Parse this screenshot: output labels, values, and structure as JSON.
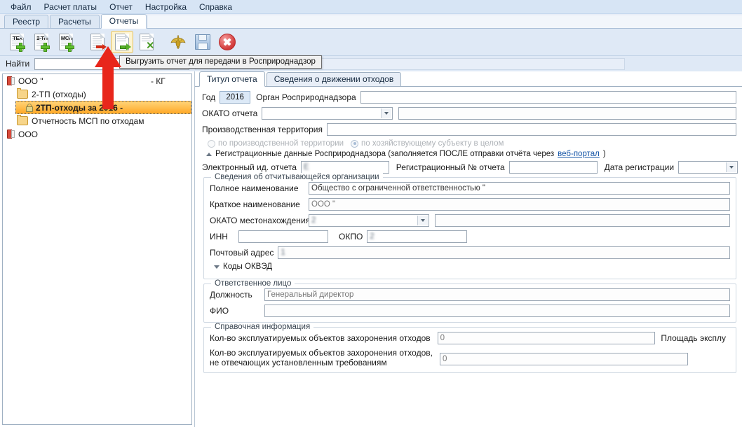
{
  "window": {
    "menu": [
      "Файл",
      "Расчет платы",
      "Отчет",
      "Настройка",
      "Справка"
    ],
    "main_tabs": [
      {
        "label": "Реестр",
        "active": false
      },
      {
        "label": "Расчеты",
        "active": false
      },
      {
        "label": "Отчеты",
        "active": true
      }
    ]
  },
  "toolbar": {
    "buttons": [
      {
        "name": "new-teh-report",
        "label": "ТЕХ",
        "icon": "document-plus-icon"
      },
      {
        "name": "new-2tp-report",
        "label": "2-ТП",
        "icon": "document-plus-icon"
      },
      {
        "name": "new-msp-report",
        "label": "МСП",
        "icon": "document-plus-icon"
      },
      {
        "name": "print-report",
        "label": "",
        "icon": "document-red-arrow-icon"
      },
      {
        "name": "export-report",
        "label": "",
        "icon": "document-green-arrow-icon"
      },
      {
        "name": "import-report",
        "label": "",
        "icon": "document-green-x-icon"
      },
      {
        "name": "rosprirodnadzor-portal",
        "label": "",
        "icon": "eagle-emblem-icon"
      },
      {
        "name": "save-report",
        "label": "",
        "icon": "floppy-save-icon"
      },
      {
        "name": "close-report",
        "label": "",
        "icon": "red-close-circle-icon"
      }
    ],
    "tooltip": "Выгрузить отчет для передачи в Росприроднадзор"
  },
  "find": {
    "label": "Найти",
    "value": "",
    "placeholder": ""
  },
  "tree": {
    "nodes": [
      {
        "level": 1,
        "icon": "book-icon",
        "text": "ООО \"",
        "blurred": "                                        ",
        "suffix": "- КГ",
        "selected": false
      },
      {
        "level": 2,
        "icon": "folder-icon",
        "text": "2-ТП (отходы)",
        "blurred": "",
        "suffix": "",
        "selected": false
      },
      {
        "level": 3,
        "icon": "lock-icon",
        "text": "2ТП-отходы за 2016 -",
        "blurred": "                   ",
        "suffix": "",
        "selected": true
      },
      {
        "level": 2,
        "icon": "folder-icon",
        "text": "Отчетность МСП по отходам",
        "blurred": "",
        "suffix": "",
        "selected": false
      },
      {
        "level": 1,
        "icon": "book-icon",
        "text": "ООО",
        "blurred": "                                            ",
        "suffix": "",
        "selected": false
      }
    ]
  },
  "form": {
    "tabs": [
      {
        "label": "Титул отчета",
        "active": true
      },
      {
        "label": "Сведения о движении отходов",
        "active": false
      }
    ],
    "year_label": "Год",
    "year_value": "2016",
    "organ_label": "Орган Росприроднадзора",
    "organ_value": "",
    "okato_report_label": "ОКАТО отчета",
    "okato_report_value": "",
    "okato_report_name": "",
    "territory_label": "Производственная территория",
    "territory_value": "",
    "radio_by_territory": "по производственной территории",
    "radio_by_entity": "по хозяйствующему субъекту в целом",
    "reg_section": "Регистрационные данные Росприроднадзора (заполняется ПОСЛЕ отправки отчёта через",
    "reg_link": "веб-портал",
    "reg_section_end": ")",
    "eid_label": "Электронный ид. отчета",
    "eid_value": "",
    "regnum_label": "Регистрационный № отчета",
    "regnum_value": "",
    "regdate_label": "Дата регистрации",
    "regdate_value": "",
    "org_group_title": "Сведения об отчитывающейся организации",
    "fullname_label": "Полное наименование",
    "fullname_value": "Общество с ограниченной ответственностью \"",
    "shortname_label": "Краткое наименование",
    "shortname_value": "ООО \"",
    "okato_loc_label": "ОКАТО местонахождения",
    "okato_loc_value": "",
    "okato_loc_name": "",
    "inn_label": "ИНН",
    "inn_value": "",
    "okpo_label": "ОКПО",
    "okpo_value": "",
    "postal_label": "Почтовый адрес",
    "postal_value": "",
    "okved_label": "Коды ОКВЭД",
    "resp_group_title": "Ответственное лицо",
    "position_label": "Должность",
    "position_value": "Генеральный директор",
    "fio_label": "ФИО",
    "fio_value": "",
    "ref_group_title": "Справочная информация",
    "ref1_label": "Кол-во эксплуатируемых объектов захоронения отходов",
    "ref1_value": "0",
    "ref1_right_label": "Площадь эксплу",
    "ref2_label_line1": "Кол-во эксплуатируемых объектов захоронения отходов,",
    "ref2_label_line2": "не отвечающих установленным требованиям",
    "ref2_value": "0"
  },
  "colors": {
    "menubar": "#d7e5f5",
    "toolbar": "#dfe9f6",
    "selection": "#ffa827",
    "link": "#1757a8",
    "pointer": "#e8261b"
  }
}
